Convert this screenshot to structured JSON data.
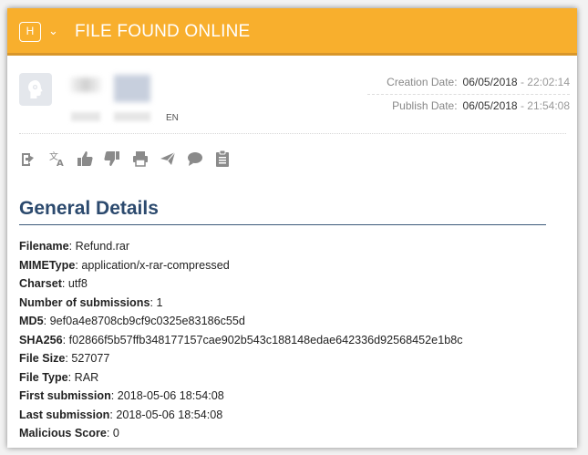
{
  "header": {
    "logo_letter": "H",
    "chevron": "⌄",
    "title": "FILE FOUND ONLINE",
    "bg_color": "#f8af2d"
  },
  "meta": {
    "language": "EN",
    "creation_label": "Creation Date:",
    "creation_date": "06/05/2018",
    "creation_time": "- 22:02:14",
    "publish_label": "Publish Date:",
    "publish_date": "06/05/2018",
    "publish_time": "- 21:54:08"
  },
  "actions": [
    {
      "icon": "export-icon"
    },
    {
      "icon": "translate-icon"
    },
    {
      "icon": "thumbs-up-icon"
    },
    {
      "icon": "thumbs-down-icon"
    },
    {
      "icon": "print-icon"
    },
    {
      "icon": "send-icon"
    },
    {
      "icon": "comment-icon"
    },
    {
      "icon": "clipboard-icon"
    }
  ],
  "section": {
    "title": "General Details",
    "title_color": "#2c4a6e"
  },
  "details": [
    {
      "key": "Filename",
      "value": "Refund.rar"
    },
    {
      "key": "MIMEType",
      "value": "application/x-rar-compressed"
    },
    {
      "key": "Charset",
      "value": "utf8"
    },
    {
      "key": "Number of submissions",
      "value": "1"
    },
    {
      "key": "MD5",
      "value": "9ef0a4e8708cb9cf9c0325e83186c55d"
    },
    {
      "key": "SHA256",
      "value": "f02866f5b57ffb348177157cae902b543c188148edae642336d92568452e1b8c"
    },
    {
      "key": "File Size",
      "value": "527077"
    },
    {
      "key": "File Type",
      "value": "RAR"
    },
    {
      "key": "First submission",
      "value": "2018-05-06 18:54:08"
    },
    {
      "key": "Last submission",
      "value": "2018-05-06 18:54:08"
    },
    {
      "key": "Malicious Score",
      "value": "0"
    }
  ]
}
